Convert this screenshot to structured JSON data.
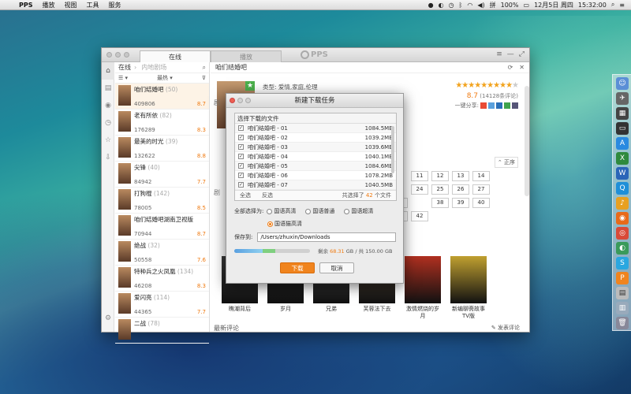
{
  "menubar": {
    "apple": "",
    "app": "PPS",
    "items": [
      "播放",
      "视图",
      "工具",
      "服务"
    ],
    "battery": "100%",
    "date": "12月5日 周四",
    "time": "15:32:00"
  },
  "window": {
    "tabs": [
      "在线",
      "播放"
    ],
    "logo": "PPS"
  },
  "list": {
    "crumb_root": "在线",
    "crumb_sub": "内地剧场",
    "sort_label": "最热",
    "items": [
      {
        "title": "咱们结婚吧",
        "count": "(50)",
        "tag": "",
        "views": "409806",
        "score": "8.7"
      },
      {
        "title": "老有所依",
        "count": "(82)",
        "tag": "",
        "views": "176289",
        "score": "8.3"
      },
      {
        "title": "最美的时光",
        "count": "(39)",
        "tag": "",
        "views": "132622",
        "score": "8.8"
      },
      {
        "title": "尖锋",
        "count": "(40)",
        "tag": "",
        "views": "84942",
        "score": "7.7"
      },
      {
        "title": "打狗棍",
        "count": "(142)",
        "tag": "",
        "views": "78005",
        "score": "8.5"
      },
      {
        "title": "咱们结婚吧湖南卫视版",
        "count": "",
        "tag": "",
        "views": "70944",
        "score": "8.7"
      },
      {
        "title": "绝战",
        "count": "(32)",
        "tag": "",
        "views": "50558",
        "score": "7.6"
      },
      {
        "title": "特种兵之火凤凰",
        "count": "(134)",
        "tag": "",
        "views": "46208",
        "score": "8.3"
      },
      {
        "title": "爱闪亮",
        "count": "(114)",
        "tag": "",
        "views": "44365",
        "score": "7.7"
      },
      {
        "title": "二战",
        "count": "(78)",
        "tag": "",
        "views": "",
        "score": ""
      }
    ]
  },
  "content": {
    "title": "咱们结婚吧",
    "genre": "类型:  爱情,家庭,伦理",
    "rating_value": "8.7",
    "rating_count": "(14128条评论)",
    "share_label": "一键分享:",
    "sort_label": "正序",
    "episodes": [
      "",
      "11",
      "12",
      "13",
      "14",
      "",
      "24",
      "25",
      "26",
      "27",
      "28",
      "",
      "38",
      "39",
      "40",
      "41",
      "42"
    ],
    "section_label_1": "剧",
    "section_label_2": "剧",
    "posters": [
      {
        "caption": "瞧潮背后"
      },
      {
        "caption": "岁月"
      },
      {
        "caption": "兄弟"
      },
      {
        "caption": "芙蓉法下去"
      },
      {
        "caption": "激情燃烧的岁月"
      },
      {
        "caption": "新编聊斋故事TV版"
      }
    ],
    "comments_label": "最新评论",
    "post_comment": "发表评论"
  },
  "dialog": {
    "title": "新建下载任务",
    "files_label": "选择下载的文件",
    "files": [
      {
        "name": "咱们结婚吧 - 01",
        "size": "1084.5MB"
      },
      {
        "name": "咱们结婚吧 - 02",
        "size": "1039.2MB"
      },
      {
        "name": "咱们结婚吧 - 03",
        "size": "1039.6MB"
      },
      {
        "name": "咱们结婚吧 - 04",
        "size": "1040.1MB"
      },
      {
        "name": "咱们结婚吧 - 05",
        "size": "1084.6MB"
      },
      {
        "name": "咱们结婚吧 - 06",
        "size": "1078.2MB"
      },
      {
        "name": "咱们结婚吧 - 07",
        "size": "1040.5MB"
      }
    ],
    "select_all": "全选",
    "invert": "反选",
    "total_prefix": "共选择了",
    "total_count": "42",
    "total_suffix": "个文件",
    "quality_label": "全部选择为:",
    "quality_options": [
      "国语高清",
      "国语普通",
      "国语超清",
      "国语猫高清"
    ],
    "quality_selected": "国语猫高清",
    "save_label": "保存到:",
    "save_path": "/Users/zhuxin/Downloads",
    "disk_free_label": "剩余",
    "disk_free": "68.31",
    "disk_total": "GB / 共 150.00 GB",
    "disk_used_fraction": 0.54,
    "download_button": "下载",
    "cancel_button": "取消"
  },
  "colors": {
    "accent": "#f0841e",
    "score": "#f07a10",
    "star": "#f2a31d"
  }
}
